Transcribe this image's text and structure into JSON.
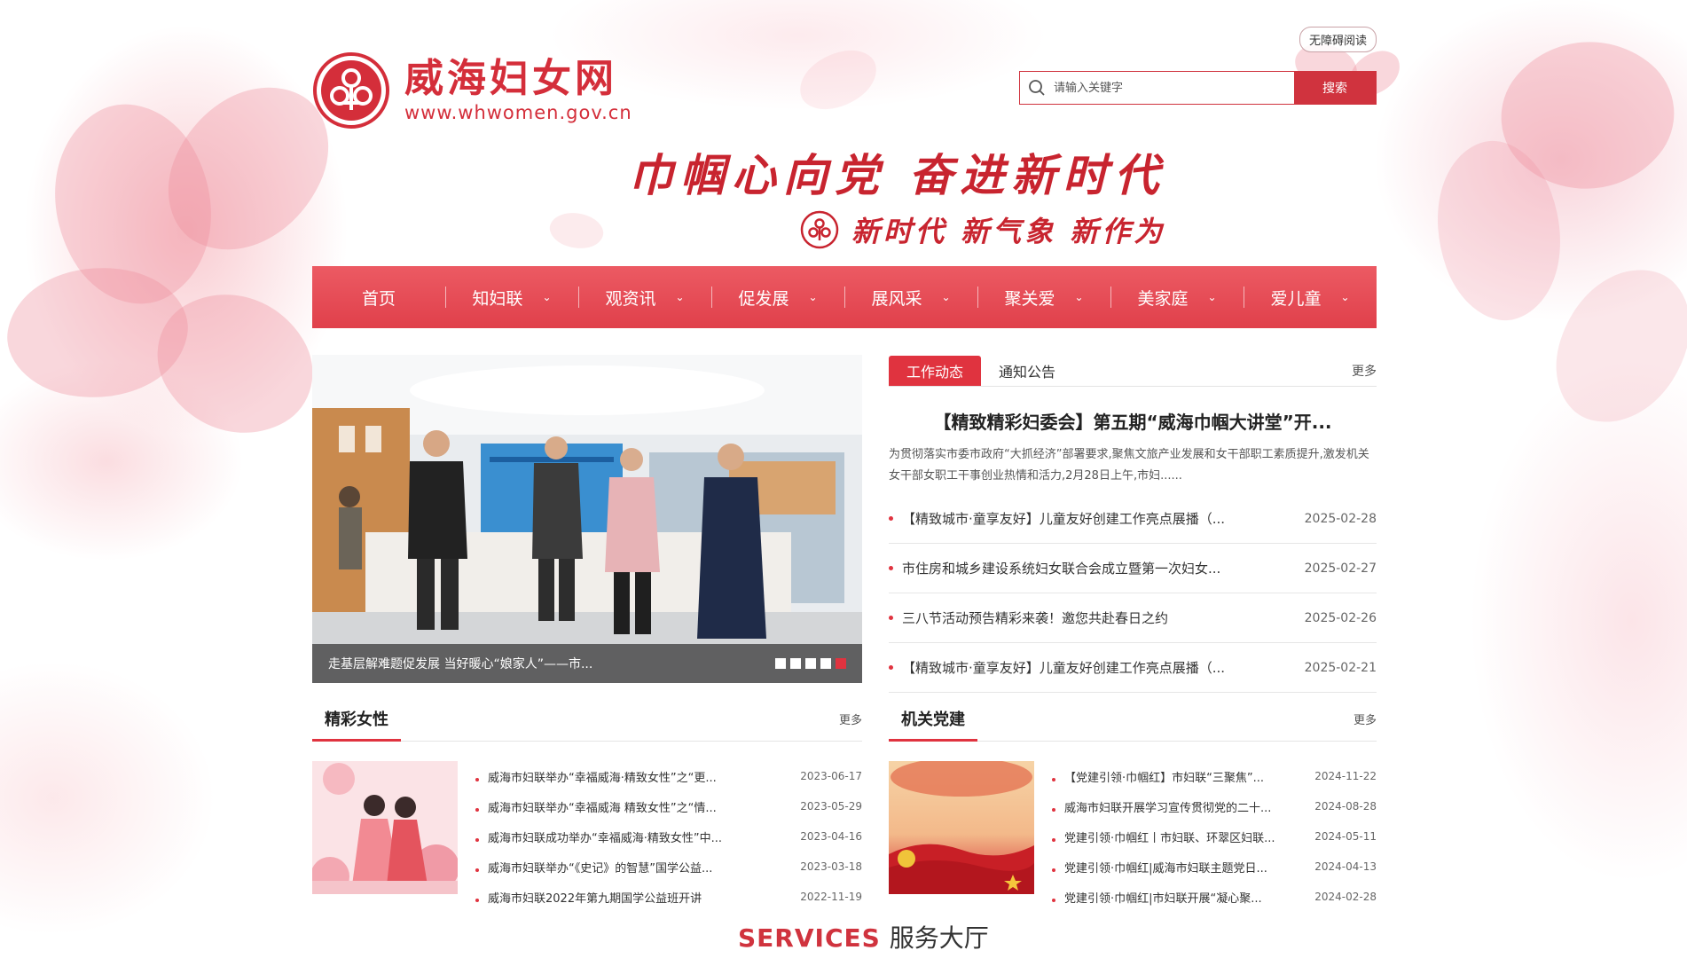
{
  "site": {
    "title": "威海妇女网",
    "url": "www.whwomen.gov.cn",
    "accessibility_label": "无障碍阅读",
    "brand_color": "#d42e3a"
  },
  "search": {
    "placeholder": "请输入关键字",
    "button_label": "搜索"
  },
  "banner": {
    "slogan_main": "巾帼心向党  奋进新时代",
    "slogan_sub": "新时代 新气象 新作为"
  },
  "nav": {
    "items": [
      {
        "label": "首页",
        "has_dropdown": false
      },
      {
        "label": "知妇联",
        "has_dropdown": true
      },
      {
        "label": "观资讯",
        "has_dropdown": true
      },
      {
        "label": "促发展",
        "has_dropdown": true
      },
      {
        "label": "展风采",
        "has_dropdown": true
      },
      {
        "label": "聚关爱",
        "has_dropdown": true
      },
      {
        "label": "美家庭",
        "has_dropdown": true
      },
      {
        "label": "爱儿童",
        "has_dropdown": true
      }
    ]
  },
  "carousel": {
    "caption": "走基层解难题促发展 当好暖心“娘家人”——市...",
    "slide_count": 5,
    "active_index": 4
  },
  "news": {
    "tabs": [
      "工作动态",
      "通知公告"
    ],
    "active_tab": 0,
    "more_label": "更多",
    "headline": "【精致精彩妇委会】第五期“威海巾帼大讲堂”开...",
    "summary": "为贯彻落实市委市政府“大抓经济”部署要求,聚焦文旅产业发展和女干部职工素质提升,激发机关女干部女职工干事创业热情和活力,2月28日上午,市妇......",
    "items": [
      {
        "title": "【精致城市·童享友好】儿童友好创建工作亮点展播（...",
        "date": "2025-02-28"
      },
      {
        "title": "市住房和城乡建设系统妇女联合会成立暨第一次妇女...",
        "date": "2025-02-27"
      },
      {
        "title": "三八节活动预告精彩来袭！邀您共赴春日之约",
        "date": "2025-02-26"
      },
      {
        "title": "【精致城市·童享友好】儿童友好创建工作亮点展播（...",
        "date": "2025-02-21"
      }
    ]
  },
  "women_section": {
    "title": "精彩女性",
    "more_label": "更多",
    "items": [
      {
        "title": "威海市妇联举办“幸福威海·精致女性”之“更...",
        "date": "2023-06-17"
      },
      {
        "title": "威海市妇联举办“幸福威海 精致女性”之“情...",
        "date": "2023-05-29"
      },
      {
        "title": "威海市妇联成功举办“幸福威海·精致女性”中...",
        "date": "2023-04-16"
      },
      {
        "title": "威海市妇联举办“《史记》的智慧”国学公益...",
        "date": "2023-03-18"
      },
      {
        "title": "威海市妇联2022年第九期国学公益班开讲",
        "date": "2022-11-19"
      }
    ]
  },
  "party_section": {
    "title": "机关党建",
    "more_label": "更多",
    "items": [
      {
        "title": "【党建引领·巾帼红】市妇联“三聚焦”...",
        "date": "2024-11-22"
      },
      {
        "title": "威海市妇联开展学习宣传贯彻党的二十...",
        "date": "2024-08-28"
      },
      {
        "title": "党建引领·巾帼红丨市妇联、环翠区妇联...",
        "date": "2024-05-11"
      },
      {
        "title": "党建引领·巾帼红|威海市妇联主题党日...",
        "date": "2024-04-13"
      },
      {
        "title": "党建引领·巾帼红|市妇联开展“凝心聚...",
        "date": "2024-02-28"
      }
    ]
  },
  "services": {
    "en": "SERVICES",
    "cn": "服务大厅"
  }
}
